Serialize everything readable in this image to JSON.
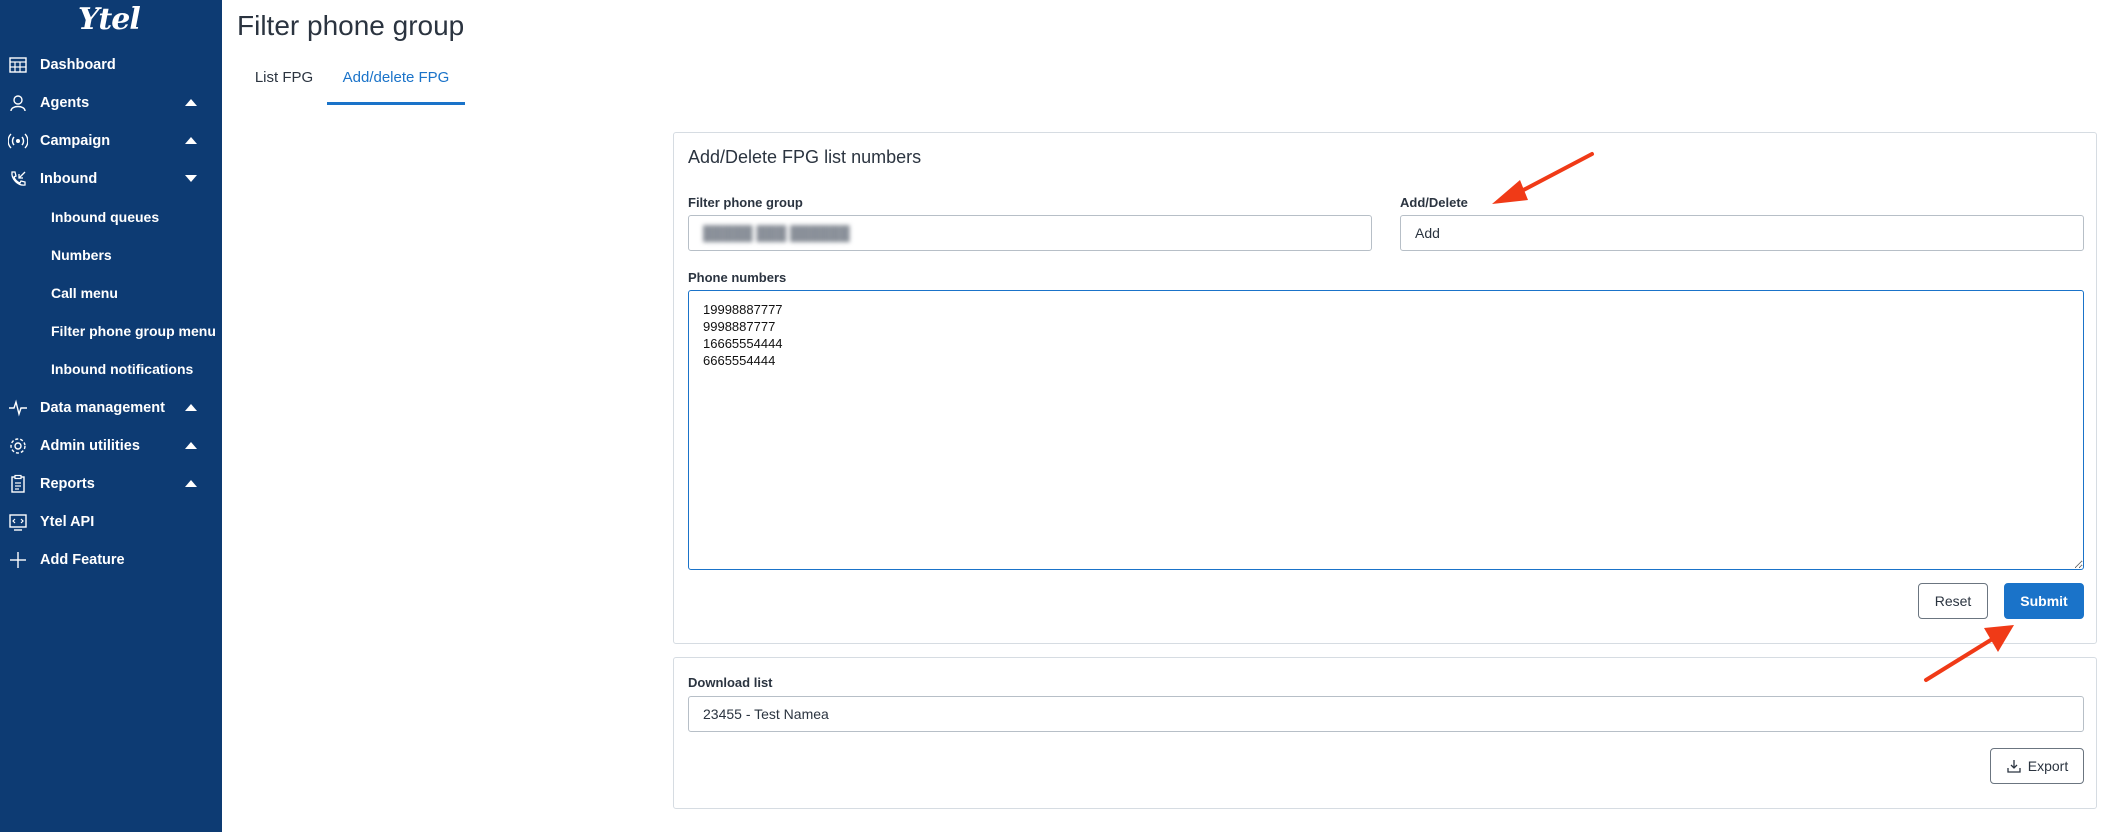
{
  "brand": {
    "logo_text": "Ytel"
  },
  "sidebar": {
    "items": [
      {
        "label": "Dashboard",
        "icon": "dashboard-icon",
        "caret": "none"
      },
      {
        "label": "Agents",
        "icon": "agent-icon",
        "caret": "up"
      },
      {
        "label": "Campaign",
        "icon": "campaign-icon",
        "caret": "up"
      },
      {
        "label": "Inbound",
        "icon": "inbound-phone-icon",
        "caret": "down"
      },
      {
        "label": "Data management",
        "icon": "pulse-icon",
        "caret": "up"
      },
      {
        "label": "Admin utilities",
        "icon": "gear-icon",
        "caret": "up"
      },
      {
        "label": "Reports",
        "icon": "clipboard-icon",
        "caret": "up"
      },
      {
        "label": "Ytel API",
        "icon": "api-icon",
        "caret": "none"
      },
      {
        "label": "Add Feature",
        "icon": "plus-icon",
        "caret": "none"
      }
    ],
    "inbound_sub": [
      {
        "label": "Inbound queues"
      },
      {
        "label": "Numbers"
      },
      {
        "label": "Call menu"
      },
      {
        "label": "Filter phone group menu"
      },
      {
        "label": "Inbound notifications"
      }
    ]
  },
  "page": {
    "title": "Filter phone group",
    "tabs": [
      {
        "label": "List FPG",
        "active": false
      },
      {
        "label": "Add/delete FPG",
        "active": true
      }
    ]
  },
  "form": {
    "title": "Add/Delete FPG list numbers",
    "filter_group_label": "Filter phone group",
    "filter_group_value": "█████ ███ ██████",
    "add_delete_label": "Add/Delete",
    "add_delete_value": "Add",
    "phone_numbers_label": "Phone numbers",
    "phone_numbers_value": "19998887777\n9998887777\n16665554444\n6665554444",
    "reset_label": "Reset",
    "submit_label": "Submit"
  },
  "download": {
    "label": "Download list",
    "value": "23455 - Test Namea",
    "export_label": "Export"
  },
  "colors": {
    "sidebar_bg": "#0d3b73",
    "accent": "#1a73c9",
    "annotation_arrow": "#f03a17"
  }
}
